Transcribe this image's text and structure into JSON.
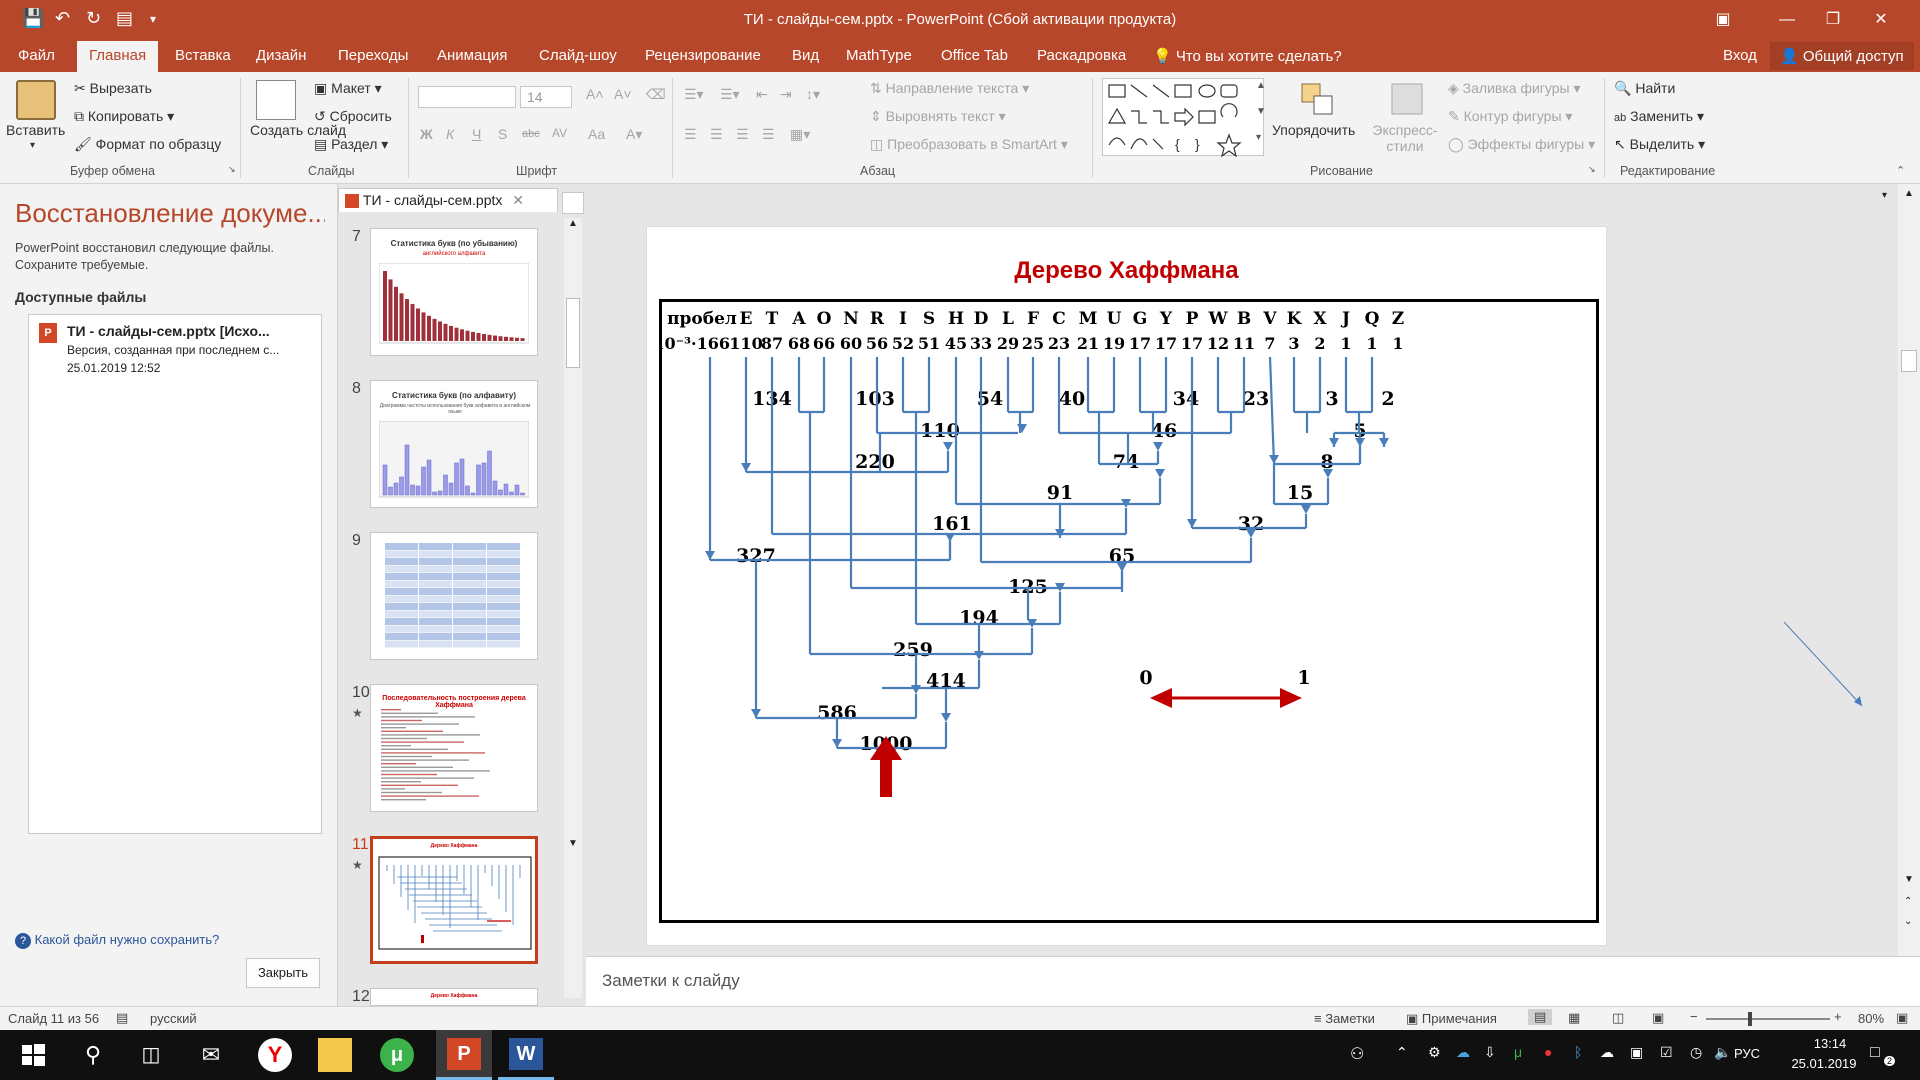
{
  "window": {
    "title": "ТИ - слайды-сем.pptx - PowerPoint (Сбой активации продукта)",
    "accent": "#b7472a"
  },
  "tabs": [
    "Файл",
    "Главная",
    "Вставка",
    "Дизайн",
    "Переходы",
    "Анимация",
    "Слайд-шоу",
    "Рецензирование",
    "Вид",
    "MathType",
    "Office Tab",
    "Раскадровка"
  ],
  "tellme": "Что вы хотите сделать?",
  "signin": "Вход",
  "share": "Общий доступ",
  "ribbon": {
    "paste": "Вставить",
    "cut": "Вырезать",
    "copy": "Копировать",
    "format_painter": "Формат по образцу",
    "clipboard_group": "Буфер обмена",
    "new_slide": "Создать слайд",
    "layout": "Макет",
    "reset": "Сбросить",
    "section": "Раздел",
    "slides_group": "Слайды",
    "font_size": "14",
    "font_group": "Шрифт",
    "bold": "Ж",
    "italic": "К",
    "underline": "Ч",
    "shadow": "S",
    "strike": "abc",
    "spacing": "AV",
    "case": "Aa",
    "text_direction": "Направление текста",
    "align_text": "Выровнять текст",
    "smartart": "Преобразовать в SmartArt",
    "paragraph_group": "Абзац",
    "arrange": "Упорядочить",
    "quick_styles": "Экспресс-стили",
    "shape_fill": "Заливка фигуры",
    "shape_outline": "Контур фигуры",
    "shape_effects": "Эффекты фигуры",
    "drawing_group": "Рисование",
    "find": "Найти",
    "replace": "Заменить",
    "select": "Выделить",
    "editing_group": "Редактирование"
  },
  "recovery": {
    "title": "Восстановление докуме...",
    "desc": "PowerPoint восстановил следующие файлы. Сохраните требуемые.",
    "available": "Доступные файлы",
    "file_name": "ТИ - слайды-сем.pptx  [Исхо...",
    "file_desc": "Версия, созданная при последнем с...",
    "file_date": "25.01.2019 12:52",
    "help": "Какой файл нужно сохранить?",
    "close": "Закрыть"
  },
  "doc_tab": "ТИ - слайды-сем.pptx",
  "thumbnails": [
    {
      "num": "7",
      "title": "Статистика букв (по убыванию)",
      "sub": "английского алфавита",
      "starred": false
    },
    {
      "num": "8",
      "title": "Статистика букв (по алфавиту)",
      "sub": "Диаграмма частоты использования букв алфавита в английском языке",
      "starred": false
    },
    {
      "num": "9",
      "title": "",
      "sub": "",
      "starred": false
    },
    {
      "num": "10",
      "title": "Последовательность построения дерева Хаффмана",
      "sub": "",
      "starred": true
    },
    {
      "num": "11",
      "title": "Дерево Хаффмана",
      "sub": "",
      "starred": true
    },
    {
      "num": "12",
      "title": "Дерево Хаффмана",
      "sub": "",
      "starred": false
    }
  ],
  "slide": {
    "title": "Дерево Хаффмана",
    "letters": [
      "пробел",
      "E",
      "T",
      "A",
      "O",
      "N",
      "R",
      "I",
      "S",
      "H",
      "D",
      "L",
      "F",
      "C",
      "M",
      "U",
      "G",
      "Y",
      "P",
      "W",
      "B",
      "V",
      "K",
      "X",
      "J",
      "Q",
      "Z"
    ],
    "freq_prefix": "10⁻³·",
    "freqs": [
      "166",
      "110",
      "87",
      "68",
      "66",
      "60",
      "56",
      "52",
      "51",
      "45",
      "33",
      "29",
      "25",
      "23",
      "21",
      "19",
      "17",
      "17",
      "17",
      "12",
      "11",
      "7",
      "3",
      "2",
      "1",
      "1",
      "1"
    ],
    "nodes": [
      "134",
      "103",
      "54",
      "40",
      "34",
      "23",
      "3",
      "2",
      "110",
      "46",
      "5",
      "220",
      "74",
      "8",
      "91",
      "15",
      "161",
      "32",
      "327",
      "65",
      "125",
      "194",
      "259",
      "414",
      "586",
      "1000"
    ],
    "legend_zero": "0",
    "legend_one": "1",
    "colors": {
      "line": "#4a7ebb",
      "title": "#c00000",
      "arrow": "#c00000"
    }
  },
  "notes_placeholder": "Заметки к слайду",
  "status": {
    "slide": "Слайд 11 из 56",
    "language": "русский",
    "notes": "Заметки",
    "comments": "Примечания",
    "zoom": "80%"
  },
  "taskbar": {
    "lang": "РУС",
    "time": "13:14",
    "date": "25.01.2019",
    "notif": "2"
  }
}
